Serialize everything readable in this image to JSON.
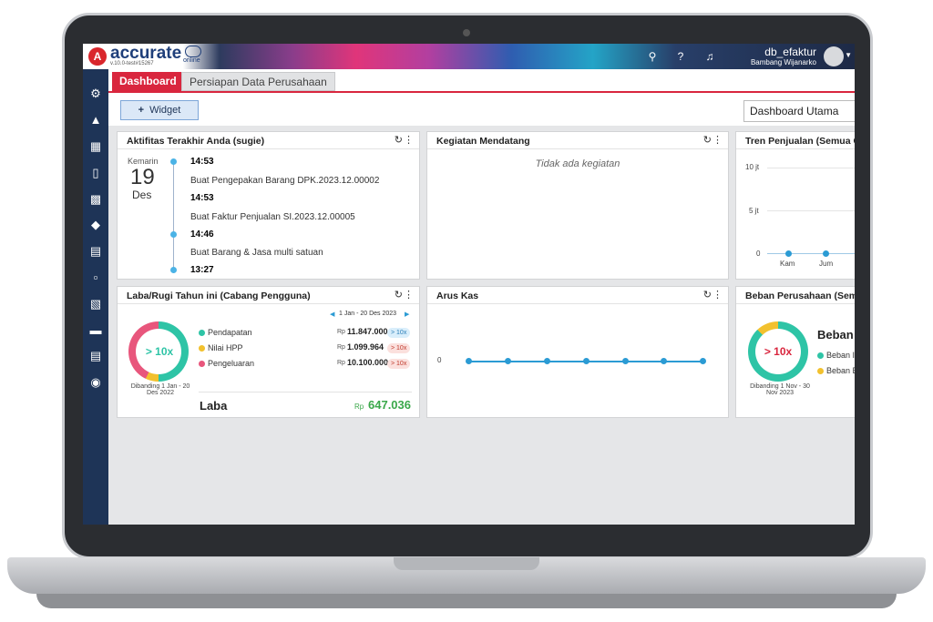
{
  "app": {
    "logo_text": "accurate",
    "logo_sub": "online",
    "version": "v.10.0-test#15267",
    "user_name": "db_efaktur",
    "user_sub": "Bambang Wijanarko"
  },
  "tabs": [
    "Dashboard",
    "Persiapan Data Perusahaan"
  ],
  "toolbar": {
    "widget_label": "Widget",
    "dashboard_select": "Dashboard Utama"
  },
  "activity": {
    "title": "Aktifitas Terakhir Anda (sugie)",
    "day_label": "Kemarin",
    "day": "19",
    "month": "Des",
    "items": [
      {
        "time": "14:53",
        "text": "Buat Pengepakan Barang DPK.2023.12.00002"
      },
      {
        "time": "14:53",
        "text": "Buat Faktur Penjualan SI.2023.12.00005"
      },
      {
        "time": "14:46",
        "text": "Buat Barang & Jasa multi satuan"
      },
      {
        "time": "13:27",
        "text": ""
      }
    ]
  },
  "upcoming": {
    "title": "Kegiatan Mendatang",
    "empty": "Tidak ada kegiatan"
  },
  "sales_trend": {
    "title": "Tren Penjualan (Semua Cab",
    "ticks": [
      "10 jt",
      "5 jt",
      "0"
    ],
    "xlabels": [
      "Kam",
      "Jum"
    ]
  },
  "profit": {
    "title": "Laba/Rugi Tahun ini (Cabang Pengguna)",
    "range": "1 Jan - 20 Des 2023",
    "ring_label": "> 10x",
    "compare": "Dibanding 1 Jan - 20 Des 2022",
    "rows": [
      {
        "label": "Pendapatan",
        "cur": "Rp",
        "value": "11.847.000",
        "badge": "> 10x",
        "color": "#2ec4a6"
      },
      {
        "label": "Nilai HPP",
        "cur": "Rp",
        "value": "1.099.964",
        "badge": "> 10x",
        "color": "#f2c12e"
      },
      {
        "label": "Pengeluaran",
        "cur": "Rp",
        "value": "10.100.000",
        "badge": "> 10x",
        "color": "#e8567c"
      }
    ],
    "profit_label": "Laba",
    "profit_cur": "Rp",
    "profit_value": "647.036"
  },
  "cashflow": {
    "title": "Arus Kas",
    "ytick": "0"
  },
  "expense": {
    "title": "Beban Perusahaan (Semua",
    "ring_label": "> 10x",
    "compare": "Dibanding 1 Nov - 30 Nov 2023",
    "heading": "Beban",
    "legend": [
      "Beban I",
      "Beban E"
    ]
  },
  "colors": {
    "brand_red": "#d9263e",
    "sidebar": "#1e3457",
    "teal": "#2ec4a6",
    "yellow": "#f2c12e",
    "pink": "#e8567c",
    "line": "#2b9bd4"
  }
}
